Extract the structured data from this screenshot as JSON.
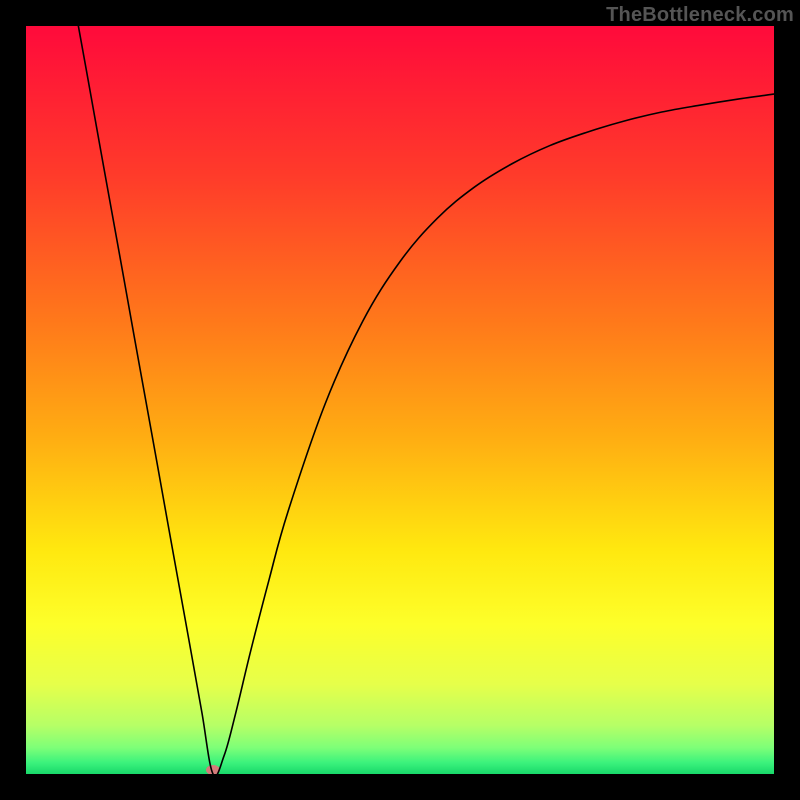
{
  "watermark": "TheBottleneck.com",
  "chart_data": {
    "type": "line",
    "title": "",
    "xlabel": "",
    "ylabel": "",
    "xlim": [
      0,
      100
    ],
    "ylim": [
      0,
      100
    ],
    "grid": false,
    "legend": false,
    "x_min_norm": 25,
    "background_gradient_stops": [
      {
        "offset": 0,
        "color": "#ff0a3b"
      },
      {
        "offset": 0.2,
        "color": "#ff3b2a"
      },
      {
        "offset": 0.4,
        "color": "#ff7a1a"
      },
      {
        "offset": 0.55,
        "color": "#ffad12"
      },
      {
        "offset": 0.7,
        "color": "#ffe80f"
      },
      {
        "offset": 0.8,
        "color": "#fdff2a"
      },
      {
        "offset": 0.88,
        "color": "#e6ff4a"
      },
      {
        "offset": 0.935,
        "color": "#b6ff66"
      },
      {
        "offset": 0.965,
        "color": "#7dff78"
      },
      {
        "offset": 0.985,
        "color": "#3bf27c"
      },
      {
        "offset": 1.0,
        "color": "#18d86a"
      }
    ],
    "data": [
      {
        "x": 7.0,
        "y": 100.0
      },
      {
        "x": 8.5,
        "y": 91.7
      },
      {
        "x": 10.0,
        "y": 83.3
      },
      {
        "x": 11.5,
        "y": 75.0
      },
      {
        "x": 13.0,
        "y": 66.7
      },
      {
        "x": 14.5,
        "y": 58.3
      },
      {
        "x": 16.0,
        "y": 50.0
      },
      {
        "x": 17.5,
        "y": 41.7
      },
      {
        "x": 19.0,
        "y": 33.3
      },
      {
        "x": 20.5,
        "y": 25.0
      },
      {
        "x": 22.0,
        "y": 16.7
      },
      {
        "x": 23.5,
        "y": 8.3
      },
      {
        "x": 25.0,
        "y": 0.0
      },
      {
        "x": 26.5,
        "y": 2.5
      },
      {
        "x": 28.0,
        "y": 8.0
      },
      {
        "x": 30.0,
        "y": 16.3
      },
      {
        "x": 32.5,
        "y": 26.0
      },
      {
        "x": 35.0,
        "y": 35.0
      },
      {
        "x": 40.0,
        "y": 49.5
      },
      {
        "x": 45.0,
        "y": 60.5
      },
      {
        "x": 50.0,
        "y": 68.5
      },
      {
        "x": 55.0,
        "y": 74.3
      },
      {
        "x": 60.0,
        "y": 78.5
      },
      {
        "x": 65.0,
        "y": 81.6
      },
      {
        "x": 70.0,
        "y": 84.0
      },
      {
        "x": 75.0,
        "y": 85.8
      },
      {
        "x": 80.0,
        "y": 87.3
      },
      {
        "x": 85.0,
        "y": 88.5
      },
      {
        "x": 90.0,
        "y": 89.4
      },
      {
        "x": 95.0,
        "y": 90.2
      },
      {
        "x": 100.0,
        "y": 90.9
      }
    ],
    "marker": {
      "x_norm": 25.0,
      "color": "#d47a7a",
      "rx": 7,
      "ry": 5
    }
  }
}
